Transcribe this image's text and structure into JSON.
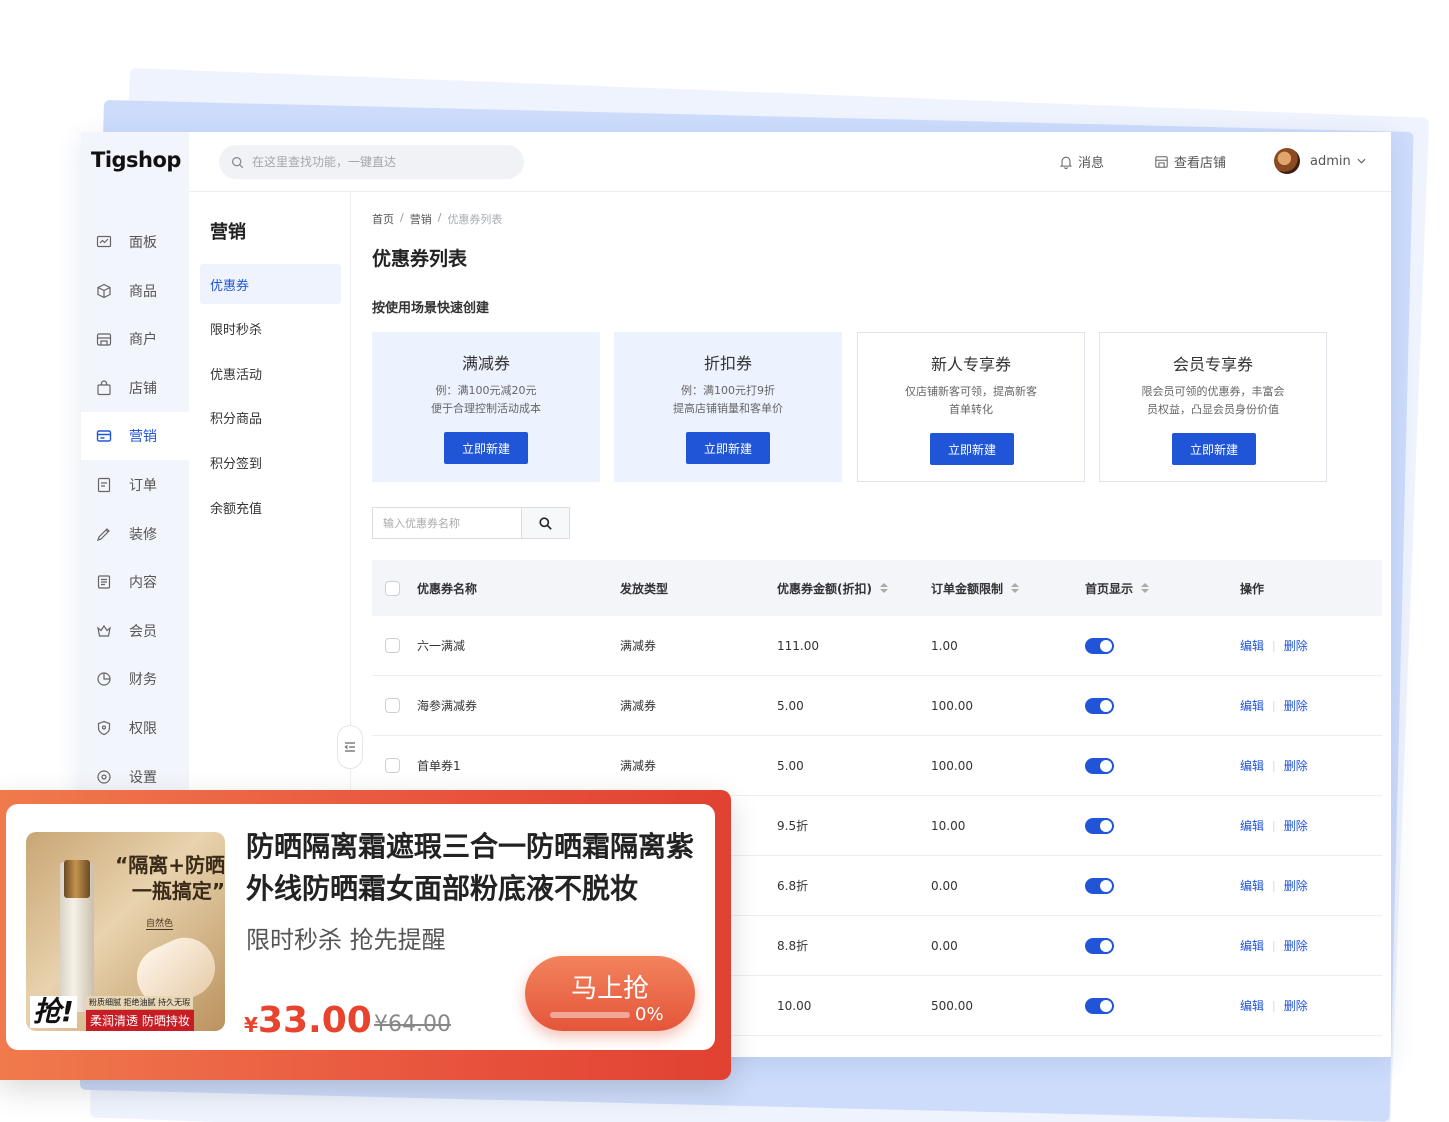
{
  "app": {
    "logo": "Tigshop",
    "colors": {
      "accent": "#2155d8",
      "promo": "#e9573f"
    }
  },
  "sidebar": {
    "items": [
      {
        "label": "面板",
        "icon": "dashboard-icon"
      },
      {
        "label": "商品",
        "icon": "box-icon"
      },
      {
        "label": "商户",
        "icon": "merchant-icon"
      },
      {
        "label": "店铺",
        "icon": "shop-bag-icon"
      },
      {
        "label": "营销",
        "icon": "marketing-icon",
        "active": true
      },
      {
        "label": "订单",
        "icon": "order-icon"
      },
      {
        "label": "装修",
        "icon": "decorate-icon"
      },
      {
        "label": "内容",
        "icon": "content-icon"
      },
      {
        "label": "会员",
        "icon": "member-icon"
      },
      {
        "label": "财务",
        "icon": "finance-icon"
      },
      {
        "label": "权限",
        "icon": "permission-icon"
      },
      {
        "label": "设置",
        "icon": "settings-icon"
      }
    ]
  },
  "header": {
    "search_placeholder": "在这里查找功能，一键直达",
    "messages": "消息",
    "view_store": "查看店铺",
    "user": "admin"
  },
  "submenu": {
    "title": "营销",
    "items": [
      "优惠券",
      "限时秒杀",
      "优惠活动",
      "积分商品",
      "积分签到",
      "余额充值"
    ],
    "active": "优惠券"
  },
  "main": {
    "breadcrumb": [
      "首页",
      "营销",
      "优惠券列表"
    ],
    "title": "优惠券列表",
    "quick_title": "按使用场景快速创建",
    "quick_cards": [
      {
        "title": "满减券",
        "desc1": "例：满100元减20元",
        "desc2": "便于合理控制活动成本",
        "button": "立即新建"
      },
      {
        "title": "折扣券",
        "desc1": "例：满100元打9折",
        "desc2": "提高店铺销量和客单价",
        "button": "立即新建"
      },
      {
        "title": "新人专享券",
        "desc1": "仅店铺新客可领，提高新客",
        "desc2": "首单转化",
        "button": "立即新建"
      },
      {
        "title": "会员专享券",
        "desc1": "限会员可领的优惠券，丰富会",
        "desc2": "员权益，凸显会员身份价值",
        "button": "立即新建"
      }
    ],
    "filter_placeholder": "输入优惠券名称"
  },
  "table": {
    "columns": [
      "优惠券名称",
      "发放类型",
      "优惠券金额(折扣)",
      "订单金额限制",
      "首页显示",
      "操作"
    ],
    "edit": "编辑",
    "delete": "删除",
    "rows": [
      {
        "name": "六一满减",
        "type": "满减券",
        "amount": "111.00",
        "limit": "1.00",
        "home": true
      },
      {
        "name": "海参满减券",
        "type": "满减券",
        "amount": "5.00",
        "limit": "100.00",
        "home": true
      },
      {
        "name": "首单券1",
        "type": "满减券",
        "amount": "5.00",
        "limit": "100.00",
        "home": true
      },
      {
        "name": "",
        "type": "",
        "amount": "9.5折",
        "limit": "10.00",
        "home": true
      },
      {
        "name": "",
        "type": "",
        "amount": "6.8折",
        "limit": "0.00",
        "home": true
      },
      {
        "name": "",
        "type": "",
        "amount": "8.8折",
        "limit": "0.00",
        "home": true
      },
      {
        "name": "",
        "type": "",
        "amount": "10.00",
        "limit": "500.00",
        "home": true
      }
    ]
  },
  "promo": {
    "title": "防晒隔离霜遮瑕三合一防晒霜隔离紫外线防晒霜女面部粉底液不脱妆",
    "subtitle": "限时秒杀 抢先提醒",
    "currency": "¥",
    "price": "33.00",
    "old_price": "¥64.00",
    "button": "马上抢",
    "progress_label": "0%",
    "progress": 0,
    "image_text": {
      "headline": "“隔离+防晒 一瓶搞定”",
      "shade": "自然色",
      "grab": "抢!",
      "tag_small": "粉质细腻 拒绝油腻 持久无瑕",
      "tag_big": "柔润清透 防晒持妆"
    }
  }
}
